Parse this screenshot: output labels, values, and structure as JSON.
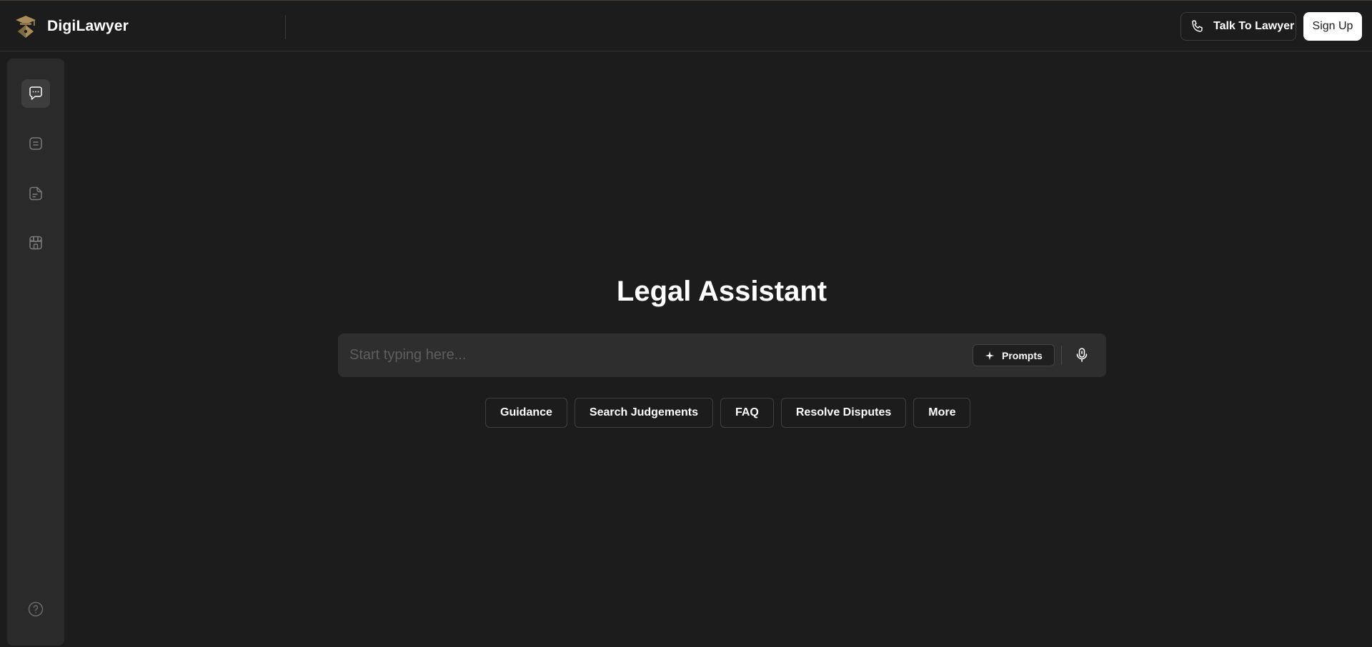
{
  "app": {
    "brand_name": "DigiLawyer"
  },
  "header": {
    "talk_to_lawyer_label": "Talk To Lawyer",
    "sign_up_label": "Sign Up"
  },
  "sidebar": {
    "items": [
      {
        "id": "chat",
        "icon": "chat-bubble-icon",
        "active": true
      },
      {
        "id": "notes",
        "icon": "notes-icon",
        "active": false
      },
      {
        "id": "document",
        "icon": "document-icon",
        "active": false
      },
      {
        "id": "marketplace",
        "icon": "storefront-icon",
        "active": false
      }
    ],
    "help_icon": "help-circle-icon"
  },
  "main": {
    "title": "Legal Assistant",
    "search": {
      "placeholder": "Start typing here...",
      "value": "",
      "prompts_label": "Prompts"
    },
    "chips": [
      "Guidance",
      "Search Judgements",
      "FAQ",
      "Resolve Disputes",
      "More"
    ]
  },
  "colors": {
    "background": "#1c1c1c",
    "sidebar": "#2a2a2a",
    "input": "#2e2e2e",
    "brand_gold": "#a88d5a",
    "text": "#ffffff"
  }
}
